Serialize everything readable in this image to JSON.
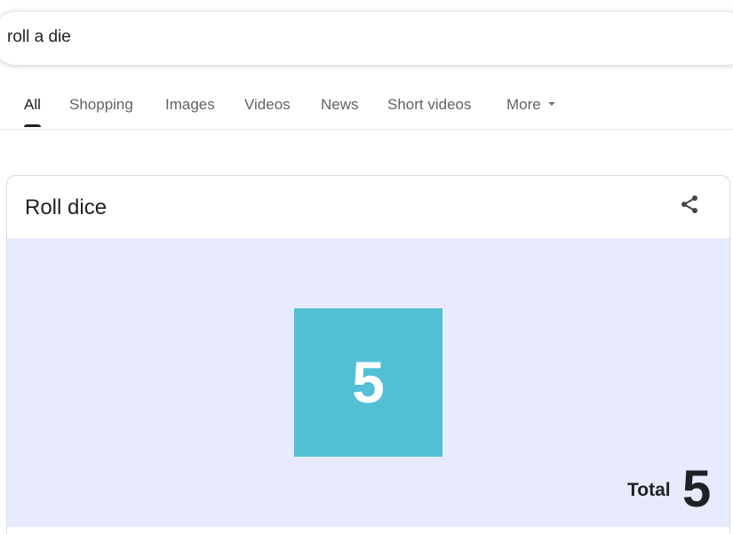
{
  "search": {
    "query": "roll a die"
  },
  "tabs": [
    {
      "label": "All",
      "active": true
    },
    {
      "label": "Shopping"
    },
    {
      "label": "Images"
    },
    {
      "label": "Videos"
    },
    {
      "label": "News"
    },
    {
      "label": "Short videos"
    },
    {
      "label": "More"
    }
  ],
  "card": {
    "title": "Roll dice",
    "share_icon": "share-icon",
    "die": {
      "value": "5",
      "color": "#53bfd4"
    },
    "background_color": "#e8ebfd",
    "total_label": "Total",
    "total_value": "5"
  }
}
